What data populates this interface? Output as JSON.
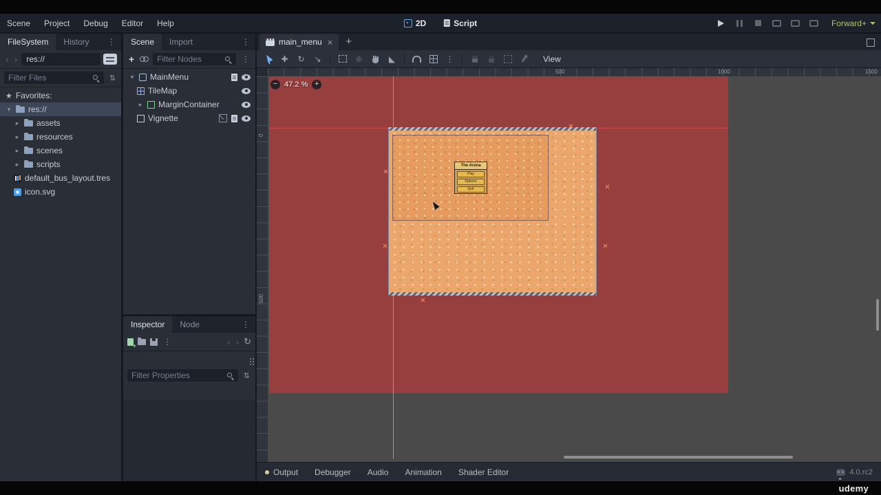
{
  "colors": {
    "accent_blue": "#79aef5",
    "scene_red": "#963f3e",
    "game_orange": "#eba66c",
    "renderer_green": "#b5c16b"
  },
  "menubar": {
    "items": [
      "Scene",
      "Project",
      "Debug",
      "Editor",
      "Help"
    ],
    "workspaces": [
      "2D",
      "Script"
    ],
    "renderer": "Forward+"
  },
  "filesystem": {
    "tabs": [
      "FileSystem",
      "History"
    ],
    "path": "res://",
    "filter_placeholder": "Filter Files",
    "items": [
      "Favorites:",
      "res://",
      "assets",
      "resources",
      "scenes",
      "scripts",
      "default_bus_layout.tres",
      "icon.svg"
    ]
  },
  "scene_panel": {
    "tabs": [
      "Scene",
      "Import"
    ],
    "filter_placeholder": "Filter Nodes",
    "nodes": [
      "MainMenu",
      "TileMap",
      "MarginContainer",
      "Vignette"
    ]
  },
  "inspector_panel": {
    "tabs": [
      "Inspector",
      "Node"
    ],
    "filter_placeholder": "Filter Properties"
  },
  "viewport": {
    "tab_title": "main_menu",
    "zoom": "47.2 %",
    "view_button": "View",
    "ruler_top_labels": [
      "500",
      "1000",
      "1500"
    ],
    "ruler_left_labels": [
      "0",
      "500"
    ],
    "game": {
      "title": "The Arena",
      "menu_buttons": [
        "Play",
        "Options",
        "Quit"
      ]
    }
  },
  "bottom_bar": {
    "tabs": [
      "Output",
      "Debugger",
      "Audio",
      "Animation",
      "Shader Editor"
    ],
    "version": "4.0.rc2"
  },
  "watermark": "udemy"
}
